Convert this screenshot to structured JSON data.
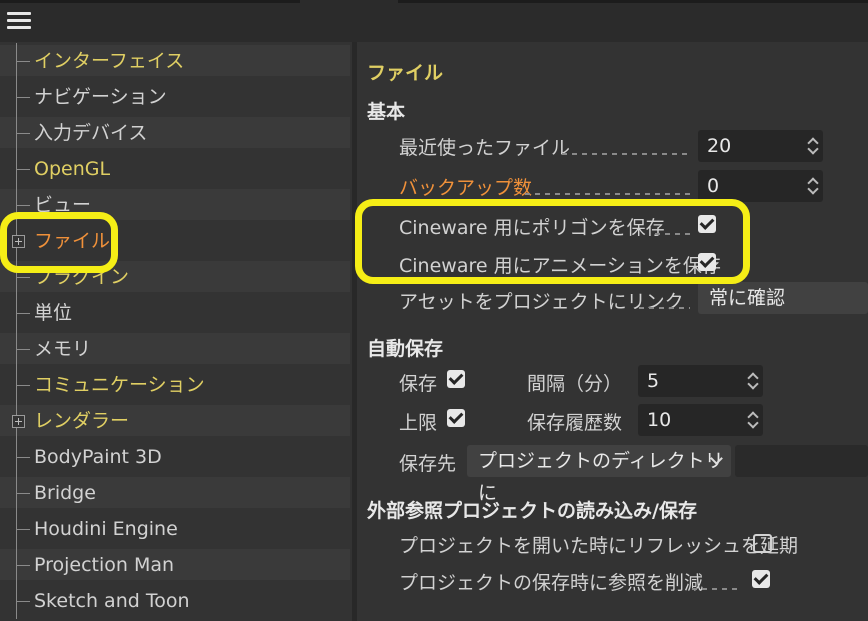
{
  "sidebar": {
    "items": [
      {
        "label": "インターフェイス",
        "color": "#e0cf63"
      },
      {
        "label": "ナビゲーション",
        "color": "#d2d2d2"
      },
      {
        "label": "入力デバイス",
        "color": "#d2d2d2"
      },
      {
        "label": "OpenGL",
        "color": "#e0cf63"
      },
      {
        "label": "ビュー",
        "color": "#d2d2d2"
      },
      {
        "label": "ファイル",
        "color": "#f0913a"
      },
      {
        "label": "プラグイン",
        "color": "#e0cf63"
      },
      {
        "label": "単位",
        "color": "#d2d2d2"
      },
      {
        "label": "メモリ",
        "color": "#d2d2d2"
      },
      {
        "label": "コミュニケーション",
        "color": "#e0cf63"
      },
      {
        "label": "レンダラー",
        "color": "#e0cf63"
      },
      {
        "label": "BodyPaint 3D",
        "color": "#d2d2d2"
      },
      {
        "label": "Bridge",
        "color": "#d2d2d2"
      },
      {
        "label": "Houdini Engine",
        "color": "#d2d2d2"
      },
      {
        "label": "Projection Man",
        "color": "#d2d2d2"
      },
      {
        "label": "Sketch and Toon",
        "color": "#d2d2d2"
      }
    ]
  },
  "main": {
    "page_title": "ファイル",
    "basic": {
      "title": "基本",
      "recent_files_label": "最近使ったファイル",
      "recent_files_value": "20",
      "backup_count_label": "バックアップ数",
      "backup_count_value": "0",
      "cineware_polygon_label": "Cineware 用にポリゴンを保存",
      "cineware_polygon_checked": true,
      "cineware_anim_label": "Cineware 用にアニメーションを保存",
      "cineware_anim_checked": true,
      "asset_link_label": "アセットをプロジェクトにリンク",
      "asset_link_value": "常に確認"
    },
    "autosave": {
      "title": "自動保存",
      "save_label": "保存",
      "save_checked": true,
      "interval_label": "間隔（分）",
      "interval_value": "5",
      "limit_label": "上限",
      "limit_checked": true,
      "history_label": "保存履歴数",
      "history_value": "10",
      "dest_label": "保存先",
      "dest_value": "プロジェクトのディレクトリに"
    },
    "xref": {
      "title": "外部参照プロジェクトの読み込み/保存",
      "defer_refresh_label": "プロジェクトを開いた時にリフレッシュを延期",
      "defer_refresh_checked": false,
      "remove_refs_label": "プロジェクトの保存時に参照を削減",
      "remove_refs_checked": true
    }
  },
  "colors": {
    "highlight": "#f5ee16",
    "accent_yellow": "#e0cf63",
    "accent_orange": "#f0913a"
  }
}
